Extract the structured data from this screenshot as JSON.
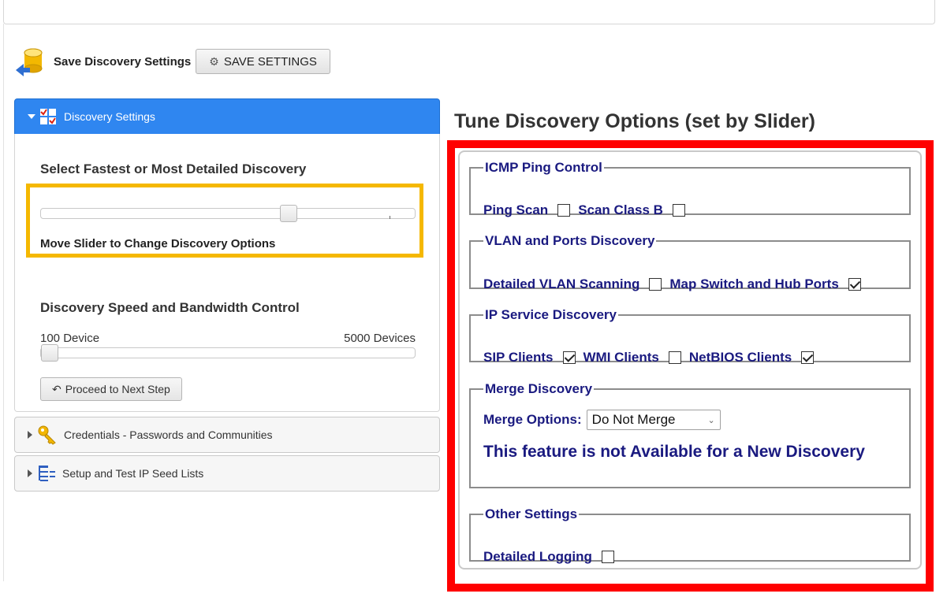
{
  "save": {
    "label": "Save Discovery Settings",
    "button_label": "SAVE SETTINGS"
  },
  "accordion": {
    "active_header": "Discovery Settings",
    "detail_title": "Select Fastest or Most Detailed Discovery",
    "detail_hint": "Move Slider to Change Discovery Options",
    "detail_slider_value": 0.67,
    "speed_title": "Discovery Speed and Bandwidth Control",
    "speed_min_label": "100 Device",
    "speed_max_label": "5000 Devices",
    "speed_slider_value": 0.0,
    "proceed_label": "Proceed to Next Step",
    "credentials_header": "Credentials - Passwords and Communities",
    "seed_header": "Setup and Test IP Seed Lists"
  },
  "tune": {
    "title": "Tune Discovery Options (set by Slider)",
    "icmp": {
      "legend": "ICMP Ping Control",
      "ping_scan": {
        "label": "Ping Scan",
        "checked": false
      },
      "scan_class_b": {
        "label": "Scan Class B",
        "checked": false
      }
    },
    "vlan": {
      "legend": "VLAN and Ports Discovery",
      "detailed_vlan": {
        "label": "Detailed VLAN Scanning",
        "checked": false
      },
      "map_switch": {
        "label": "Map Switch and Hub Ports",
        "checked": true
      }
    },
    "ip_service": {
      "legend": "IP Service Discovery",
      "sip": {
        "label": "SIP Clients",
        "checked": true
      },
      "wmi": {
        "label": "WMI Clients",
        "checked": false
      },
      "netbios": {
        "label": "NetBIOS Clients",
        "checked": true
      }
    },
    "merge": {
      "legend": "Merge Discovery",
      "options_label": "Merge Options:",
      "selected": "Do Not Merge",
      "notice": "This feature is not Available for a New Discovery"
    },
    "other": {
      "legend": "Other Settings",
      "detailed_logging": {
        "label": "Detailed Logging",
        "checked": false
      }
    }
  },
  "colors": {
    "accent": "#2f86f0",
    "highlight_yellow": "#f5b800",
    "highlight_red": "#ff0000",
    "label_navy": "#1a1a80"
  },
  "icons": [
    "database-icon",
    "gear-icon",
    "checklist-icon",
    "undo-arrow-icon",
    "key-icon",
    "list-tree-icon"
  ]
}
